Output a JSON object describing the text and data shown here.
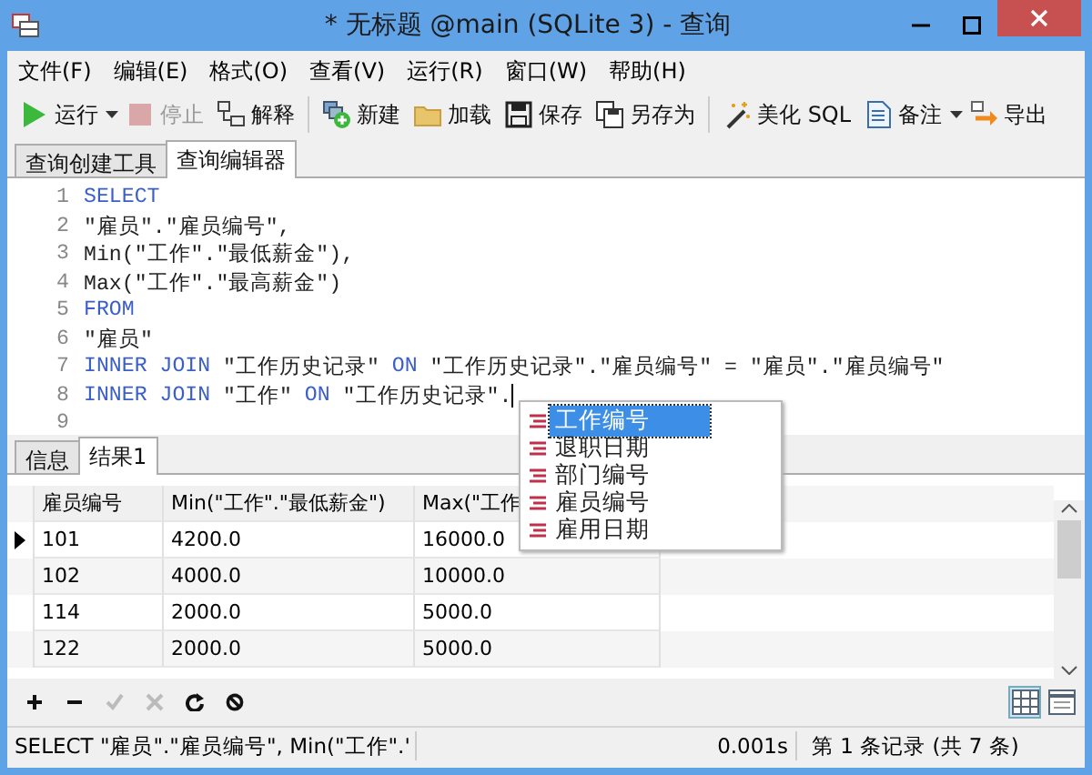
{
  "window": {
    "title": "* 无标题 @main (SQLite 3) - 查询"
  },
  "menu": [
    "文件(F)",
    "编辑(E)",
    "格式(O)",
    "查看(V)",
    "运行(R)",
    "窗口(W)",
    "帮助(H)"
  ],
  "toolbar": [
    [
      {
        "label": "运行",
        "disabled": false,
        "dropdown": true
      },
      {
        "label": "停止",
        "disabled": true,
        "dropdown": false
      },
      {
        "label": "解释",
        "disabled": false,
        "dropdown": false
      }
    ],
    [
      {
        "label": "新建",
        "disabled": false,
        "dropdown": false
      },
      {
        "label": "加载",
        "disabled": false,
        "dropdown": false
      },
      {
        "label": "保存",
        "disabled": false,
        "dropdown": false
      },
      {
        "label": "另存为",
        "disabled": false,
        "dropdown": false
      }
    ],
    [
      {
        "label": "美化 SQL",
        "disabled": false,
        "dropdown": false
      },
      {
        "label": "备注",
        "disabled": false,
        "dropdown": true
      },
      {
        "label": "导出",
        "disabled": false,
        "dropdown": false
      }
    ]
  ],
  "query_tabs": [
    {
      "label": "查询创建工具",
      "selected": false
    },
    {
      "label": "查询编辑器",
      "selected": true
    }
  ],
  "editor": {
    "lines": [
      {
        "number": "1",
        "cursor": false,
        "tokens": [
          {
            "kind": "keyword",
            "text": "SELECT"
          }
        ]
      },
      {
        "number": "2",
        "cursor": false,
        "tokens": [
          {
            "kind": "plain",
            "text": "\"雇员\".\"雇员编号\","
          }
        ]
      },
      {
        "number": "3",
        "cursor": false,
        "tokens": [
          {
            "kind": "plain",
            "text": "Min(\"工作\".\"最低薪金\"),"
          }
        ]
      },
      {
        "number": "4",
        "cursor": false,
        "tokens": [
          {
            "kind": "plain",
            "text": "Max(\"工作\".\"最高薪金\")"
          }
        ]
      },
      {
        "number": "5",
        "cursor": false,
        "tokens": [
          {
            "kind": "keyword",
            "text": "FROM"
          }
        ]
      },
      {
        "number": "6",
        "cursor": false,
        "tokens": [
          {
            "kind": "plain",
            "text": "\"雇员\""
          }
        ]
      },
      {
        "number": "7",
        "cursor": false,
        "tokens": [
          {
            "kind": "keyword",
            "text": "INNER JOIN"
          },
          {
            "kind": "plain",
            "text": " \"工作历史记录\" "
          },
          {
            "kind": "keyword",
            "text": "ON"
          },
          {
            "kind": "plain",
            "text": " \"工作历史记录\".\"雇员编号\" = \"雇员\".\"雇员编号\""
          }
        ]
      },
      {
        "number": "8",
        "cursor": true,
        "tokens": [
          {
            "kind": "keyword",
            "text": "INNER JOIN"
          },
          {
            "kind": "plain",
            "text": " \"工作\" "
          },
          {
            "kind": "keyword",
            "text": "ON"
          },
          {
            "kind": "plain",
            "text": " \"工作历史记录\"."
          }
        ]
      },
      {
        "number": "9",
        "cursor": false
      }
    ],
    "autocomplete": [
      {
        "label": "工作编号",
        "selected": true
      },
      {
        "label": "退职日期",
        "selected": false
      },
      {
        "label": "部门编号",
        "selected": false
      },
      {
        "label": "雇员编号",
        "selected": false
      },
      {
        "label": "雇用日期",
        "selected": false
      }
    ]
  },
  "result_tabs": [
    {
      "label": "信息",
      "selected": false
    },
    {
      "label": "结果1",
      "selected": true
    }
  ],
  "grid": {
    "columns": [
      "雇员编号",
      "Min(\"工作\".\"最低薪金\")",
      "Max(\"工作"
    ],
    "rows": [
      {
        "current": true,
        "cells": [
          "101",
          "4200.0",
          "16000.0"
        ]
      },
      {
        "current": false,
        "cells": [
          "102",
          "4000.0",
          "10000.0"
        ]
      },
      {
        "current": false,
        "cells": [
          "114",
          "2000.0",
          "5000.0"
        ]
      },
      {
        "current": false,
        "cells": [
          "122",
          "2000.0",
          "5000.0"
        ]
      }
    ]
  },
  "grid_tools": [
    {
      "disabled": false
    },
    {
      "disabled": false
    },
    {
      "disabled": true
    },
    {
      "disabled": true
    },
    {
      "disabled": false
    },
    {
      "disabled": false
    }
  ],
  "views": [
    {
      "selected": true
    },
    {
      "selected": false
    }
  ],
  "status_bar": [
    "SELECT \"雇员\".\"雇员编号\", Min(\"工作\".'",
    "0.001s",
    "第 1 条记录 (共 7 条)"
  ]
}
